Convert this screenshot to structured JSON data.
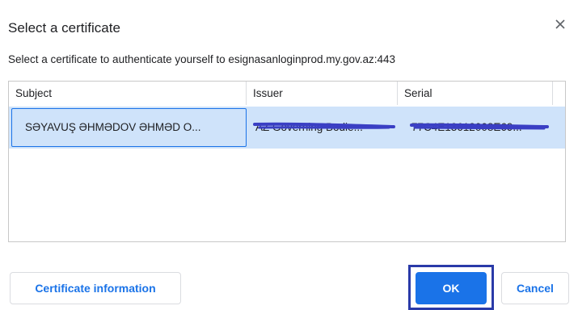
{
  "dialog": {
    "title": "Select a certificate",
    "subtitle": "Select a certificate to authenticate yourself to esignasanloginprod.my.gov.az:443"
  },
  "table": {
    "columns": [
      "Subject",
      "Issuer",
      "Serial"
    ],
    "rows": [
      {
        "subject": "SƏYAVUŞ ƏHMƏDOV ƏHMƏD O...",
        "issuer": "AZ Governing Bodie...",
        "serial": "77C4E13612008E69..."
      }
    ]
  },
  "buttons": {
    "certificate_info": "Certificate information",
    "ok": "OK",
    "cancel": "Cancel"
  },
  "icons": {
    "close": "close-icon"
  },
  "colors": {
    "accent": "#1a73e8",
    "selected_row": "#cfe3fa",
    "redaction": "#3a3fc4",
    "focus_frame": "#2a3aa8"
  }
}
